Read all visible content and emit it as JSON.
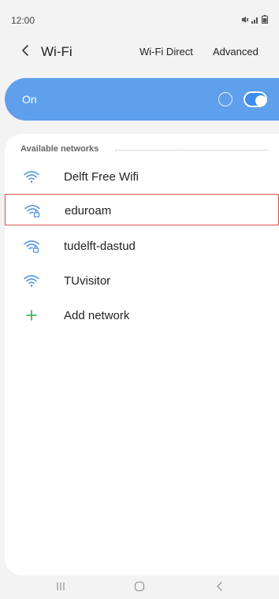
{
  "status_bar": {
    "time": "12:00",
    "icons": [
      "mute-icon",
      "signal-icon",
      "battery-icon"
    ]
  },
  "app_bar": {
    "title": "Wi-Fi",
    "wifi_direct_label": "Wi-Fi Direct",
    "advanced_label": "Advanced"
  },
  "wifi_toggle": {
    "label": "On",
    "state": "on",
    "accent_color": "#5ea0ec"
  },
  "networks": {
    "section_title": "Available networks",
    "items": [
      {
        "name": "Delft Free Wifi",
        "icon": "wifi-icon",
        "secured": false
      },
      {
        "name": "eduroam",
        "icon": "wifi-lock-icon",
        "secured": true,
        "selected": true
      },
      {
        "name": "tudelft-dastud",
        "icon": "wifi-lock-icon",
        "secured": true
      },
      {
        "name": "TUvisitor",
        "icon": "wifi-icon",
        "secured": false
      }
    ],
    "add_network_label": "Add network"
  },
  "nav_bar": {
    "buttons": [
      "recent-apps-icon",
      "home-icon",
      "back-icon"
    ]
  },
  "colors": {
    "wifi_icon": "#4a90e2",
    "add_icon": "#2eaa4f",
    "selection_border": "#d9534f"
  }
}
